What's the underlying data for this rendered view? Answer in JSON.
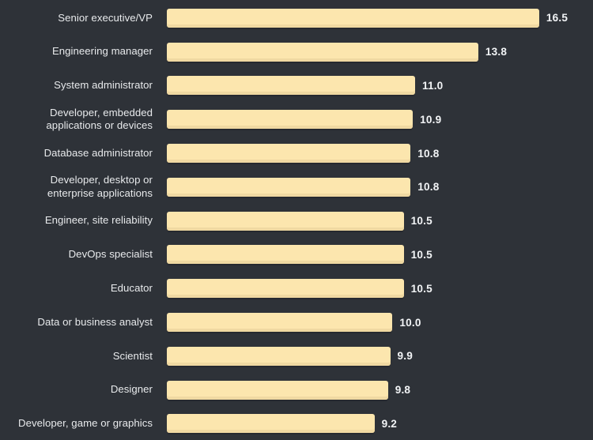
{
  "colors": {
    "background": "#2e3238",
    "bar_fill": "#fce6ae",
    "bar_shadow": "#dec48e",
    "category_text": "#e8eaec",
    "value_text": "#f2f4f6"
  },
  "chart_data": {
    "type": "bar",
    "orientation": "horizontal",
    "title": "",
    "subtitle": "",
    "xlabel": "",
    "ylabel": "",
    "grid": false,
    "legend": null,
    "axis_visible": false,
    "tick_labels": [],
    "xlim": [
      0,
      16.5
    ],
    "value_label_format": "one-decimal",
    "categories": [
      "Senior executive/VP",
      "Engineering manager",
      "System administrator",
      "Developer, embedded\napplications or devices",
      "Database administrator",
      "Developer, desktop or\nenterprise applications",
      "Engineer, site reliability",
      "DevOps specialist",
      "Educator",
      "Data or business analyst",
      "Scientist",
      "Designer",
      "Developer, game or graphics"
    ],
    "values": [
      16.5,
      13.8,
      11.0,
      10.9,
      10.8,
      10.8,
      10.5,
      10.5,
      10.5,
      10.0,
      9.9,
      9.8,
      9.2
    ],
    "value_labels": [
      "16.5",
      "13.8",
      "11.0",
      "10.9",
      "10.8",
      "10.8",
      "10.5",
      "10.5",
      "10.5",
      "10.0",
      "9.9",
      "9.8",
      "9.2"
    ]
  }
}
